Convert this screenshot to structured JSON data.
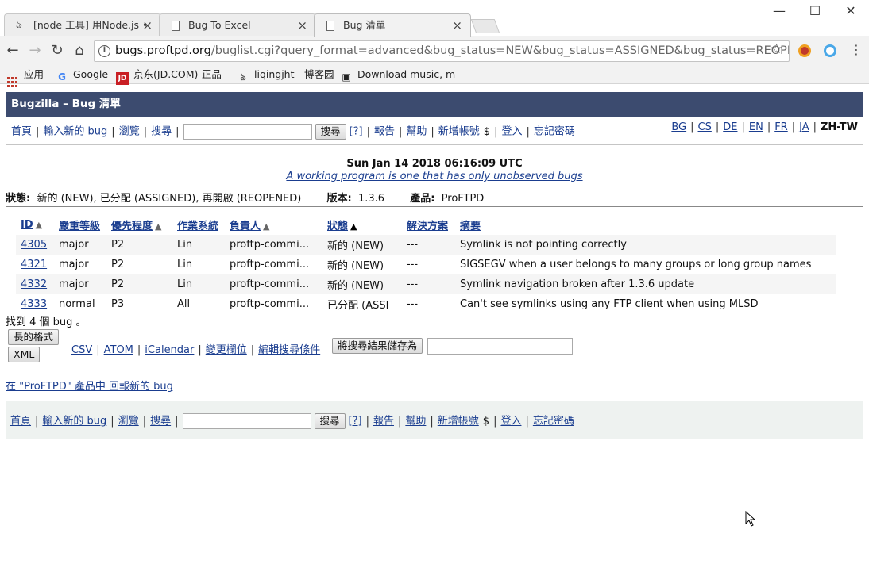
{
  "browser": {
    "tabs": [
      {
        "title": "[node 工具] 用Node.js •",
        "active": false
      },
      {
        "title": "Bug To Excel",
        "active": false
      },
      {
        "title": "Bug 清單",
        "active": true
      }
    ],
    "close_glyph": "×",
    "url_host": "bugs.proftpd.org",
    "url_rest": "/buglist.cgi?query_format=advanced&bug_status=NEW&bug_status=ASSIGNED&bug_status=REOPEN...",
    "bookmarks": [
      {
        "label": "应用",
        "icon": "apps-icon"
      },
      {
        "label": "Google",
        "icon": "google-icon"
      },
      {
        "label": "京东(JD.COM)-正品",
        "icon": "jd-icon"
      },
      {
        "label": "liqingjht - 博客园",
        "icon": "cnblogs-icon"
      },
      {
        "label": "Download music, m",
        "icon": "music-icon"
      }
    ]
  },
  "bugzilla": {
    "header_title": "Bugzilla – Bug 清單",
    "nav": {
      "home": "首頁",
      "new_bug": "輸入新的 bug",
      "browse": "瀏覽",
      "search": "搜尋",
      "search_button": "搜尋",
      "help_q": "[?]",
      "reports": "報告",
      "help": "幫助",
      "new_account": "新增帳號",
      "dollar": "$",
      "login": "登入",
      "forgot_password": "忘記密碼"
    },
    "languages": [
      "BG",
      "CS",
      "DE",
      "EN",
      "FR",
      "JA",
      "ZH-TW"
    ],
    "current_language": "ZH-TW",
    "timestamp": "Sun Jan 14 2018 06:16:09 UTC",
    "quip": "A working program is one that has only unobserved bugs",
    "criteria": {
      "status_label": "狀態:",
      "status_value": "新的 (NEW), 已分配 (ASSIGNED), 再開啟 (REOPENED)",
      "version_label": "版本:",
      "version_value": "1.3.6",
      "product_label": "產品:",
      "product_value": "ProFTPD"
    },
    "table": {
      "columns": [
        {
          "label": "ID",
          "arrow": "▲",
          "dark": false
        },
        {
          "label": "嚴重等級",
          "arrow": "",
          "dark": false
        },
        {
          "label": "優先程度",
          "arrow": "▲",
          "dark": false
        },
        {
          "label": "作業系統",
          "arrow": "",
          "dark": false
        },
        {
          "label": "負責人",
          "arrow": "▲",
          "dark": false
        },
        {
          "label": "狀態",
          "arrow": "▲",
          "dark": true
        },
        {
          "label": "解決方案",
          "arrow": "",
          "dark": false
        },
        {
          "label": "摘要",
          "arrow": "",
          "dark": false
        }
      ],
      "rows": [
        {
          "id": "4305",
          "severity": "major",
          "priority": "P2",
          "os": "Lin",
          "assignee": "proftp-commi...",
          "status": "新的 (NEW)",
          "resolution": "---",
          "summary": "Symlink is not pointing correctly"
        },
        {
          "id": "4321",
          "severity": "major",
          "priority": "P2",
          "os": "Lin",
          "assignee": "proftp-commi...",
          "status": "新的 (NEW)",
          "resolution": "---",
          "summary": "SIGSEGV when a user belongs to many groups or long group names"
        },
        {
          "id": "4332",
          "severity": "major",
          "priority": "P2",
          "os": "Lin",
          "assignee": "proftp-commi...",
          "status": "新的 (NEW)",
          "resolution": "---",
          "summary": "Symlink navigation broken after 1.3.6 update"
        },
        {
          "id": "4333",
          "severity": "normal",
          "priority": "P3",
          "os": "All",
          "assignee": "proftp-commi...",
          "status": "已分配 (ASSI",
          "resolution": "---",
          "summary": "Can't see symlinks using any FTP client when using MLSD"
        }
      ]
    },
    "found_text": "找到 4 個 bug 。",
    "buttons": {
      "long_format": "長的格式",
      "xml": "XML",
      "save_search": "將搜尋結果儲存為"
    },
    "export_links": [
      "CSV",
      "ATOM",
      "iCalendar",
      "變更欄位",
      "編輯搜尋條件"
    ],
    "report_new": "在 \"ProFTPD\" 產品中 回報新的 bug"
  }
}
